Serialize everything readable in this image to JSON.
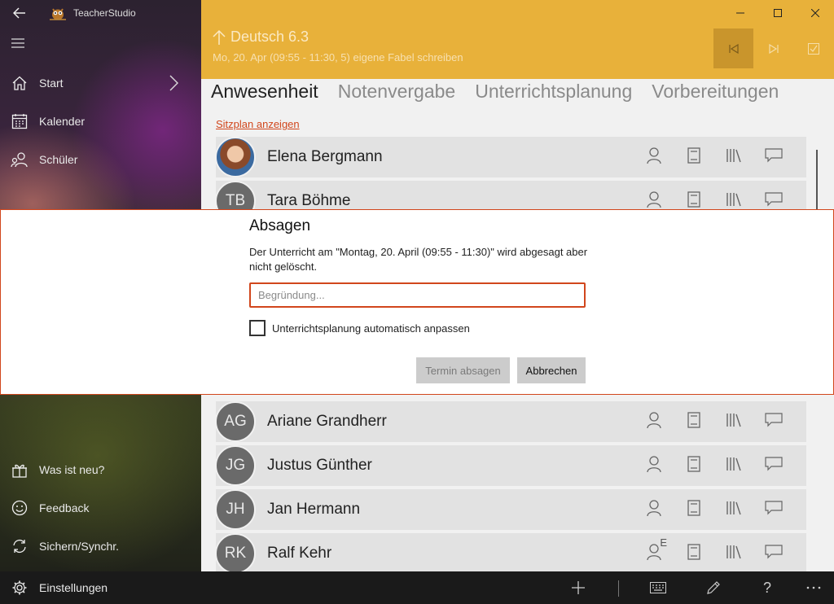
{
  "app": {
    "title": "TeacherStudio"
  },
  "sidebar": {
    "items": [
      {
        "label": "Start",
        "icon": "home-icon"
      },
      {
        "label": "Kalender",
        "icon": "calendar-icon"
      },
      {
        "label": "Schüler",
        "icon": "students-icon"
      }
    ],
    "bottom_items": [
      {
        "label": "Was ist neu?",
        "icon": "gift-icon"
      },
      {
        "label": "Feedback",
        "icon": "smiley-icon"
      },
      {
        "label": "Sichern/Synchr.",
        "icon": "sync-icon"
      },
      {
        "label": "Einstellungen",
        "icon": "gear-icon"
      }
    ]
  },
  "header": {
    "title": "Deutsch 6.3",
    "subtitle": "Mo, 20. Apr (09:55 - 11:30, 5) eigene Fabel schreiben",
    "accent": "#e8b13a"
  },
  "tabs": [
    "Anwesenheit",
    "Notenvergabe",
    "Unterrichtsplanung",
    "Vorbereitungen"
  ],
  "selected_tab": "Anwesenheit",
  "seat_plan_link": "Sitzplan anzeigen",
  "students": [
    {
      "initials": "",
      "name": "Elena Bergmann",
      "photo": true
    },
    {
      "initials": "TB",
      "name": "Tara Böhme"
    },
    {
      "initials": "AG",
      "name": "Ariane Grandherr"
    },
    {
      "initials": "JG",
      "name": "Justus Günther"
    },
    {
      "initials": "JH",
      "name": "Jan Hermann"
    },
    {
      "initials": "RK",
      "name": "Ralf Kehr",
      "mark": "E"
    }
  ],
  "dialog": {
    "title": "Absagen",
    "message": "Der Unterricht am \"Montag, 20. April (09:55 - 11:30)\" wird abgesagt aber nicht gelöscht.",
    "reason_placeholder": "Begründung...",
    "reason_value": "",
    "checkbox_label": "Unterrichtsplanung automatisch anpassen",
    "checkbox_checked": false,
    "confirm_label": "Termin absagen",
    "cancel_label": "Abbrechen",
    "accent": "#d1461c"
  }
}
